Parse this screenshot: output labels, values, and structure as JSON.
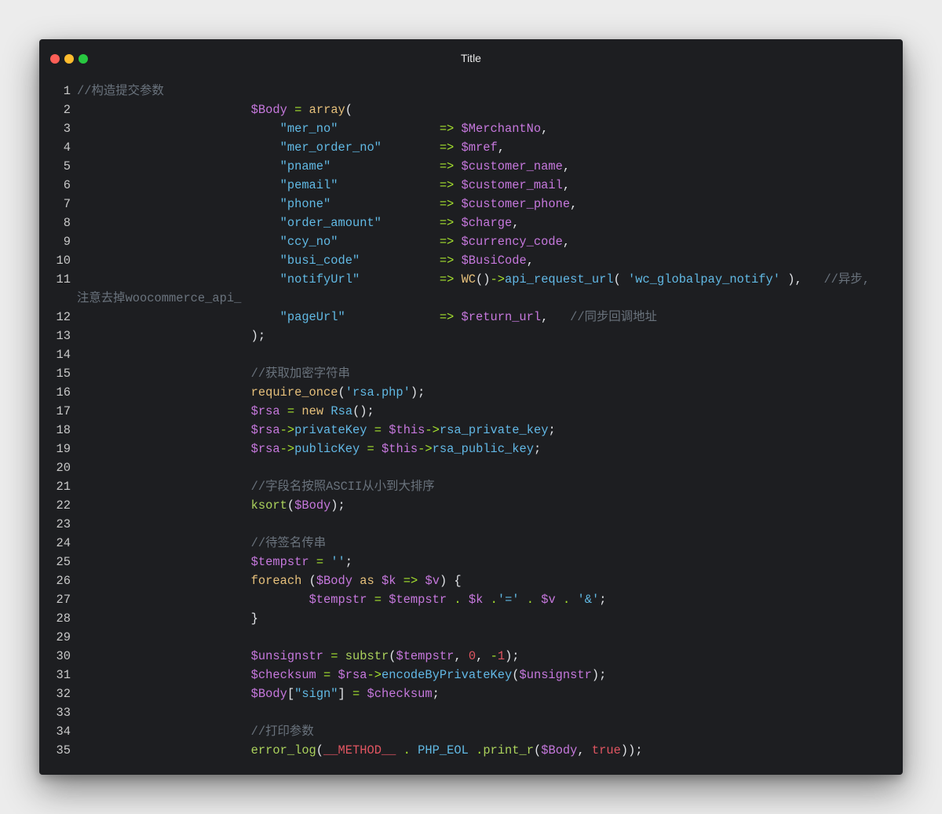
{
  "window": {
    "title": "Title"
  },
  "code": {
    "lines": [
      {
        "n": "1",
        "html": "<span class=\"c\">//构造提交参数</span>"
      },
      {
        "n": "2",
        "html": "                        <span class=\"v\">$Body</span> <span class=\"o\">=</span> <span class=\"k\">array</span>("
      },
      {
        "n": "3",
        "html": "                            <span class=\"s\">\"mer_no\"</span>              <span class=\"o\">=&gt;</span> <span class=\"v\">$MerchantNo</span>,"
      },
      {
        "n": "4",
        "html": "                            <span class=\"s\">\"mer_order_no\"</span>        <span class=\"o\">=&gt;</span> <span class=\"v\">$mref</span>,"
      },
      {
        "n": "5",
        "html": "                            <span class=\"s\">\"pname\"</span>               <span class=\"o\">=&gt;</span> <span class=\"v\">$customer_name</span>,"
      },
      {
        "n": "6",
        "html": "                            <span class=\"s\">\"pemail\"</span>              <span class=\"o\">=&gt;</span> <span class=\"v\">$customer_mail</span>,"
      },
      {
        "n": "7",
        "html": "                            <span class=\"s\">\"phone\"</span>               <span class=\"o\">=&gt;</span> <span class=\"v\">$customer_phone</span>,"
      },
      {
        "n": "8",
        "html": "                            <span class=\"s\">\"order_amount\"</span>        <span class=\"o\">=&gt;</span> <span class=\"v\">$charge</span>,"
      },
      {
        "n": "9",
        "html": "                            <span class=\"s\">\"ccy_no\"</span>              <span class=\"o\">=&gt;</span> <span class=\"v\">$currency_code</span>,"
      },
      {
        "n": "10",
        "html": "                            <span class=\"s\">\"busi_code\"</span>           <span class=\"o\">=&gt;</span> <span class=\"v\">$BusiCode</span>,"
      },
      {
        "n": "11",
        "html": "                            <span class=\"s\">\"notifyUrl\"</span>           <span class=\"o\">=&gt;</span> <span class=\"k\">WC</span>()<span class=\"o\">-&gt;</span><span class=\"m\">api_request_url</span>( <span class=\"s\">'wc_globalpay_notify'</span> ),   <span class=\"c\">//异步,注意去掉woocommerce_api_</span>"
      },
      {
        "n": "12",
        "html": "                            <span class=\"s\">\"pageUrl\"</span>             <span class=\"o\">=&gt;</span> <span class=\"v\">$return_url</span>,   <span class=\"c\">//同步回调地址</span>"
      },
      {
        "n": "13",
        "html": "                        );"
      },
      {
        "n": "14",
        "html": ""
      },
      {
        "n": "15",
        "html": "                        <span class=\"c\">//获取加密字符串</span>"
      },
      {
        "n": "16",
        "html": "                        <span class=\"k\">require_once</span>(<span class=\"s\">'rsa.php'</span>);"
      },
      {
        "n": "17",
        "html": "                        <span class=\"v\">$rsa</span> <span class=\"o\">=</span> <span class=\"k\">new</span> <span class=\"cls\">Rsa</span>();"
      },
      {
        "n": "18",
        "html": "                        <span class=\"v\">$rsa</span><span class=\"o\">-&gt;</span><span class=\"m\">privateKey</span> <span class=\"o\">=</span> <span class=\"v\">$this</span><span class=\"o\">-&gt;</span><span class=\"m\">rsa_private_key</span>;"
      },
      {
        "n": "19",
        "html": "                        <span class=\"v\">$rsa</span><span class=\"o\">-&gt;</span><span class=\"m\">publicKey</span> <span class=\"o\">=</span> <span class=\"v\">$this</span><span class=\"o\">-&gt;</span><span class=\"m\">rsa_public_key</span>;"
      },
      {
        "n": "20",
        "html": ""
      },
      {
        "n": "21",
        "html": "                        <span class=\"c\">//字段名按照ASCII从小到大排序</span>"
      },
      {
        "n": "22",
        "html": "                        <span class=\"f\">ksort</span>(<span class=\"v\">$Body</span>);"
      },
      {
        "n": "23",
        "html": ""
      },
      {
        "n": "24",
        "html": "                        <span class=\"c\">//待签名传串</span>"
      },
      {
        "n": "25",
        "html": "                        <span class=\"v\">$tempstr</span> <span class=\"o\">=</span> <span class=\"s\">''</span>;"
      },
      {
        "n": "26",
        "html": "                        <span class=\"k\">foreach</span> (<span class=\"v\">$Body</span> <span class=\"k\">as</span> <span class=\"v\">$k</span> <span class=\"o\">=&gt;</span> <span class=\"v\">$v</span>) {"
      },
      {
        "n": "27",
        "html": "                                <span class=\"v\">$tempstr</span> <span class=\"o\">=</span> <span class=\"v\">$tempstr</span> <span class=\"o\">.</span> <span class=\"v\">$k</span> <span class=\"o\">.</span><span class=\"s\">'='</span> <span class=\"o\">.</span> <span class=\"v\">$v</span> <span class=\"o\">.</span> <span class=\"s\">'&amp;'</span>;"
      },
      {
        "n": "28",
        "html": "                        }"
      },
      {
        "n": "29",
        "html": ""
      },
      {
        "n": "30",
        "html": "                        <span class=\"v\">$unsignstr</span> <span class=\"o\">=</span> <span class=\"f\">substr</span>(<span class=\"v\">$tempstr</span>, <span class=\"n\">0</span>, <span class=\"o\">-</span><span class=\"n\">1</span>);"
      },
      {
        "n": "31",
        "html": "                        <span class=\"v\">$checksum</span> <span class=\"o\">=</span> <span class=\"v\">$rsa</span><span class=\"o\">-&gt;</span><span class=\"m\">encodeByPrivateKey</span>(<span class=\"v\">$unsignstr</span>);"
      },
      {
        "n": "32",
        "html": "                        <span class=\"v\">$Body</span>[<span class=\"s\">\"sign\"</span>] <span class=\"o\">=</span> <span class=\"v\">$checksum</span>;"
      },
      {
        "n": "33",
        "html": ""
      },
      {
        "n": "34",
        "html": "                        <span class=\"c\">//打印参数</span>"
      },
      {
        "n": "35",
        "html": "                        <span class=\"f\">error_log</span>(<span class=\"n\">__METHOD__</span> <span class=\"o\">.</span> <span class=\"cls\">PHP_EOL</span> <span class=\"o\">.</span><span class=\"f\">print_r</span>(<span class=\"v\">$Body</span>, <span class=\"n\">true</span>));"
      }
    ]
  },
  "colors": {
    "window_bg": "#1d1e21",
    "close": "#fe5f57",
    "minimize": "#febc2e",
    "maximize": "#28c840"
  }
}
